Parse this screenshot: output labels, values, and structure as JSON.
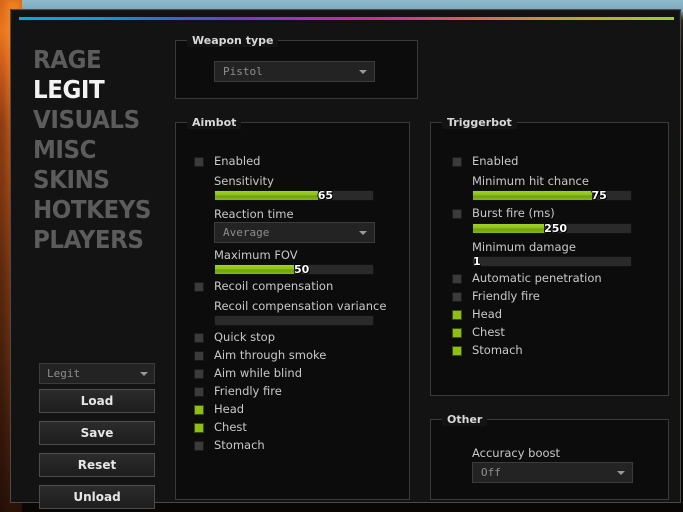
{
  "theme": {
    "accent_green": "#8fbf16",
    "active_nav": "#f2f2f2",
    "inactive_nav": "#5c5c5c",
    "window_bg": "#131313",
    "panel_bg": "#0c0c0c",
    "flame_orange": "#d9651b"
  },
  "sidebar": {
    "nav": [
      {
        "label": "RAGE",
        "active": false
      },
      {
        "label": "LEGIT",
        "active": true
      },
      {
        "label": "VISUALS",
        "active": false
      },
      {
        "label": "MISC",
        "active": false
      },
      {
        "label": "SKINS",
        "active": false
      },
      {
        "label": "HOTKEYS",
        "active": false
      },
      {
        "label": "PLAYERS",
        "active": false
      }
    ],
    "config_select": {
      "value": "Legit",
      "icon": "chevron-down-icon"
    },
    "buttons": [
      {
        "label": "Load"
      },
      {
        "label": "Save"
      },
      {
        "label": "Reset"
      },
      {
        "label": "Unload"
      }
    ]
  },
  "weapon_type": {
    "title": "Weapon type",
    "dropdown": {
      "value": "Pistol",
      "icon": "chevron-down-icon"
    }
  },
  "aimbot": {
    "title": "Aimbot",
    "enabled": {
      "label": "Enabled",
      "checked": false
    },
    "sensitivity": {
      "label": "Sensitivity",
      "value": 65,
      "percent": 65
    },
    "reaction_time": {
      "label": "Reaction time",
      "value": "Average",
      "icon": "chevron-down-icon"
    },
    "maximum_fov": {
      "label": "Maximum FOV",
      "value": 50,
      "percent": 50
    },
    "recoil_compensation": {
      "label": "Recoil compensation",
      "checked": false
    },
    "recoil_compensation_variance": {
      "label": "Recoil compensation variance",
      "value": "",
      "percent": 0
    },
    "options": [
      {
        "label": "Quick stop",
        "checked": false
      },
      {
        "label": "Aim through smoke",
        "checked": false
      },
      {
        "label": "Aim while blind",
        "checked": false
      },
      {
        "label": "Friendly fire",
        "checked": false
      },
      {
        "label": "Head",
        "checked": true
      },
      {
        "label": "Chest",
        "checked": true
      },
      {
        "label": "Stomach",
        "checked": false
      }
    ]
  },
  "triggerbot": {
    "title": "Triggerbot",
    "enabled": {
      "label": "Enabled",
      "checked": false
    },
    "minimum_hit_chance": {
      "label": "Minimum hit chance",
      "value": 75,
      "percent": 75
    },
    "burst_fire": {
      "label": "Burst fire (ms)",
      "checked": false,
      "value": 250,
      "percent": 45
    },
    "minimum_damage": {
      "label": "Minimum damage",
      "value": 1,
      "percent": 0
    },
    "options": [
      {
        "label": "Automatic penetration",
        "checked": false
      },
      {
        "label": "Friendly fire",
        "checked": false
      },
      {
        "label": "Head",
        "checked": true
      },
      {
        "label": "Chest",
        "checked": true
      },
      {
        "label": "Stomach",
        "checked": true
      }
    ]
  },
  "other": {
    "title": "Other",
    "accuracy_boost": {
      "label": "Accuracy boost",
      "value": "Off",
      "icon": "chevron-down-icon"
    }
  }
}
